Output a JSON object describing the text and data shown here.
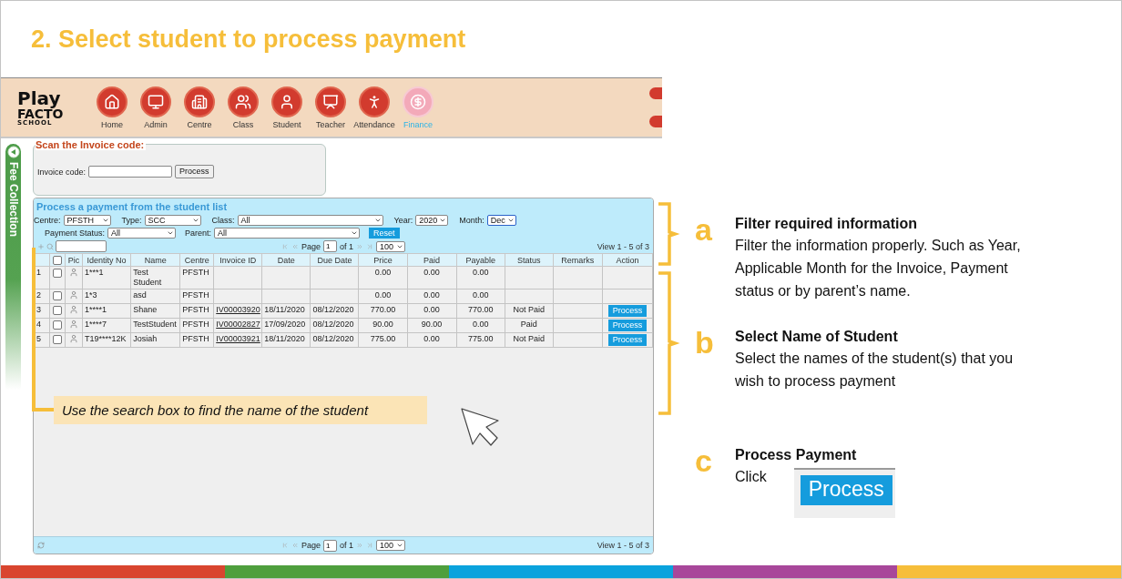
{
  "slide": {
    "title": "2. Select student to process payment"
  },
  "app": {
    "logo": [
      "Play",
      "FACTO",
      "SCHOOL"
    ],
    "nav": [
      {
        "label": "Home",
        "selected": false
      },
      {
        "label": "Admin",
        "selected": false
      },
      {
        "label": "Centre",
        "selected": false
      },
      {
        "label": "Class",
        "selected": false
      },
      {
        "label": "Student",
        "selected": false
      },
      {
        "label": "Teacher",
        "selected": false
      },
      {
        "label": "Attendance",
        "selected": false
      },
      {
        "label": "Finance",
        "selected": true
      }
    ],
    "side_tab": "Fee Collection",
    "scan": {
      "legend": "Scan the Invoice code:",
      "label": "Invoice code:",
      "button": "Process"
    },
    "grid": {
      "title": "Process a payment from the student list",
      "filters": [
        [
          {
            "label": "Centre:",
            "value": "PFSTH"
          },
          {
            "label": "Type:",
            "value": "SCC"
          },
          {
            "label": "Class:",
            "value": "All"
          },
          {
            "label": "Year:",
            "value": "2020"
          },
          {
            "label": "Month:",
            "value": "Dec"
          }
        ],
        [
          {
            "label": "Payment Status:",
            "value": "All"
          },
          {
            "label": "Parent:",
            "value": "All"
          }
        ]
      ],
      "reset": "Reset",
      "pager_top": {
        "page_label": "Page",
        "page": "1",
        "of": "of 1",
        "per_page": "100",
        "view": "View 1 - 5 of 3"
      },
      "columns": [
        "Pic",
        "Identity No",
        "Name",
        "Centre",
        "Invoice ID",
        "Date",
        "Due Date",
        "Price",
        "Paid",
        "Payable",
        "Status",
        "Remarks",
        "Action"
      ],
      "header_checked": false,
      "rows": [
        {
          "no": "1",
          "checked": false,
          "identity": "1***1",
          "name": "Test Student",
          "centre": "PFSTH",
          "price": "0.00",
          "paid": "0.00",
          "payable": "0.00"
        },
        {
          "no": "2",
          "checked": false,
          "identity": "1*3",
          "name": "asd",
          "centre": "PFSTH",
          "price": "0.00",
          "paid": "0.00",
          "payable": "0.00"
        },
        {
          "no": "3",
          "checked": false,
          "identity": "1****1",
          "name": "Shane",
          "centre": "PFSTH",
          "invoice": "IV00003920",
          "date": "18/11/2020",
          "due": "08/12/2020",
          "price": "770.00",
          "paid": "0.00",
          "payable": "770.00",
          "status": "Not Paid",
          "action": "Process"
        },
        {
          "no": "4",
          "checked": false,
          "identity": "1****7",
          "name": "TestStudent",
          "centre": "PFSTH",
          "invoice": "IV00002827",
          "date": "17/09/2020",
          "due": "08/12/2020",
          "price": "90.00",
          "paid": "90.00",
          "payable": "0.00",
          "status": "Paid",
          "action": "Process"
        },
        {
          "no": "5",
          "checked": false,
          "identity": "T19****12K",
          "name": "Josiah",
          "centre": "PFSTH",
          "invoice": "IV00003921",
          "date": "18/11/2020",
          "due": "08/12/2020",
          "price": "775.00",
          "paid": "0.00",
          "payable": "775.00",
          "status": "Not Paid",
          "action": "Process"
        }
      ],
      "pager_bottom": {
        "page_label": "Page",
        "page": "1",
        "of": "of 1",
        "per_page": "100",
        "view": "View 1 - 5 of 3"
      }
    },
    "callout": "Use the search box to find the name of the student"
  },
  "annotations": [
    {
      "letter": "a",
      "title": "Filter required information",
      "body": "Filter the information properly. Such as Year, Applicable Month for the Invoice, Payment status or by parent’s name."
    },
    {
      "letter": "b",
      "title": "Select Name of Student",
      "body": "Select the names of the student(s) that you wish to process payment"
    },
    {
      "letter": "c",
      "title": "Process Payment",
      "body": "Click",
      "button": "Process"
    }
  ]
}
